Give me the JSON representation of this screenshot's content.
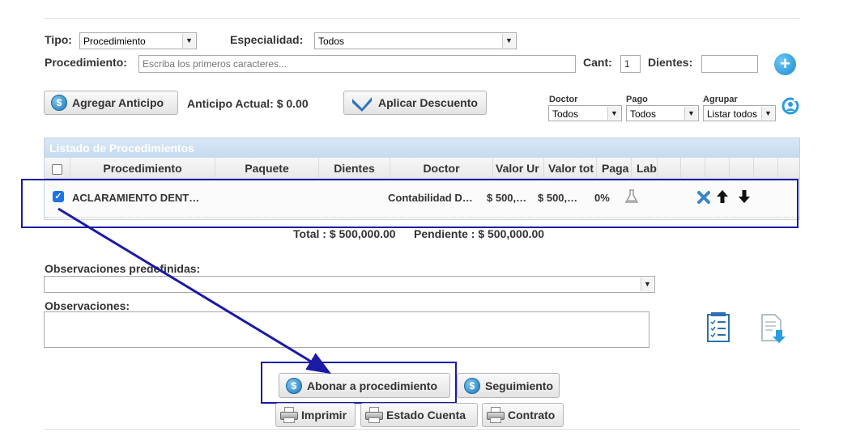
{
  "filters": {
    "tipo_label": "Tipo:",
    "tipo_value": "Procedimiento",
    "especialidad_label": "Especialidad:",
    "especialidad_value": "Todos",
    "procedimiento_label": "Procedimiento:",
    "procedimiento_placeholder": "Escriba los primeros caracteres...",
    "cant_label": "Cant:",
    "cant_value": "1",
    "dientes_label": "Dientes:",
    "dientes_value": ""
  },
  "actions": {
    "agregar_anticipo": "Agregar Anticipo",
    "anticipo_actual": "Anticipo Actual: $ 0.00",
    "aplicar_descuento": "Aplicar Descuento"
  },
  "grid_filters": {
    "doctor_label": "Doctor",
    "doctor_value": "Todos",
    "pago_label": "Pago",
    "pago_value": "Todos",
    "agrupar_label": "Agrupar",
    "agrupar_value": "Listar todos"
  },
  "table": {
    "title": "Listado de Procedimientos",
    "headers": [
      "Procedimiento",
      "Paquete",
      "Dientes",
      "Doctor",
      "Valor Ur",
      "Valor tot",
      "Paga",
      "Lab"
    ],
    "rows": [
      {
        "checked": true,
        "procedimiento": "ACLARAMIENTO DENT…",
        "paquete": "",
        "dientes": "",
        "doctor": "Contabilidad D…",
        "valor_unitario": "$ 500,…",
        "valor_total": "$ 500,…",
        "pagado": "0%"
      }
    ]
  },
  "totals": {
    "total": "Total : $ 500,000.00",
    "pendiente": "Pendiente : $ 500,000.00"
  },
  "observaciones": {
    "predefinidas_label": "Observaciones predefinidas:",
    "predefinidas_value": "",
    "label": "Observaciones:",
    "value": ""
  },
  "bottom_buttons": {
    "abonar": "Abonar a procedimiento",
    "seguimiento": "Seguimiento",
    "imprimir": "Imprimir",
    "estado_cuenta": "Estado Cuenta",
    "contrato": "Contrato"
  },
  "colors": {
    "annotation": "#1a1aa6",
    "table_header": "#c9ddf2",
    "plus_button": "#2a9de0"
  }
}
